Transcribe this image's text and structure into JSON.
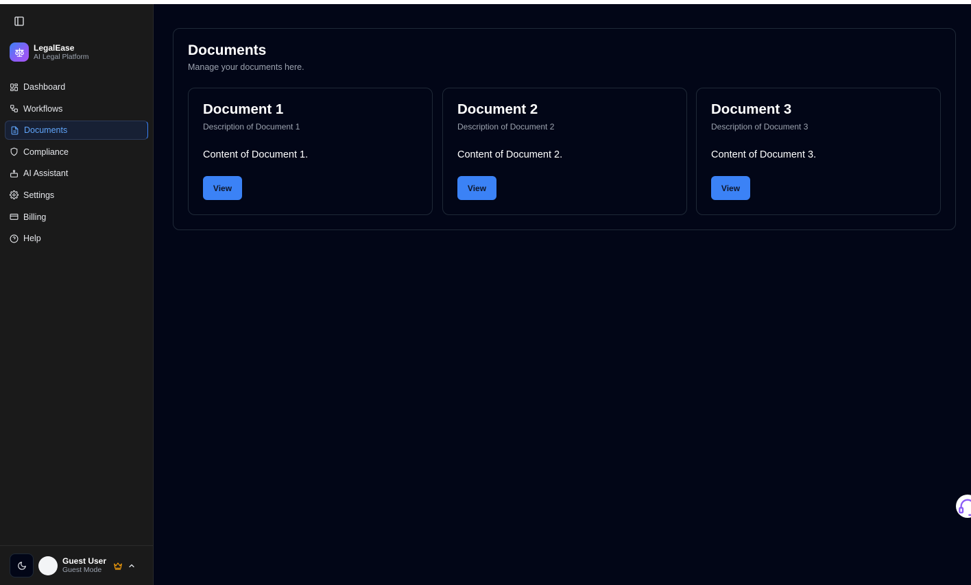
{
  "brand": {
    "name": "LegalEase",
    "subtitle": "AI Legal Platform"
  },
  "nav": [
    {
      "label": "Dashboard",
      "icon": "dashboard-icon"
    },
    {
      "label": "Workflows",
      "icon": "workflow-icon"
    },
    {
      "label": "Documents",
      "icon": "document-icon",
      "active": true
    },
    {
      "label": "Compliance",
      "icon": "shield-icon"
    },
    {
      "label": "AI Assistant",
      "icon": "bot-icon"
    },
    {
      "label": "Settings",
      "icon": "gear-icon"
    },
    {
      "label": "Billing",
      "icon": "credit-card-icon"
    },
    {
      "label": "Help",
      "icon": "help-circle-icon"
    }
  ],
  "user": {
    "name": "Guest User",
    "mode": "Guest Mode"
  },
  "page": {
    "title": "Documents",
    "subtitle": "Manage your documents here."
  },
  "documents": [
    {
      "title": "Document 1",
      "description": "Description of Document 1",
      "content": "Content of Document 1.",
      "button": "View"
    },
    {
      "title": "Document 2",
      "description": "Description of Document 2",
      "content": "Content of Document 2.",
      "button": "View"
    },
    {
      "title": "Document 3",
      "description": "Description of Document 3",
      "content": "Content of Document 3.",
      "button": "View"
    }
  ],
  "colors": {
    "background": "#020617",
    "sidebar": "#1a1a1a",
    "accent": "#3b82f6",
    "active_text": "#60a5fa",
    "crown": "#f59e0b"
  }
}
